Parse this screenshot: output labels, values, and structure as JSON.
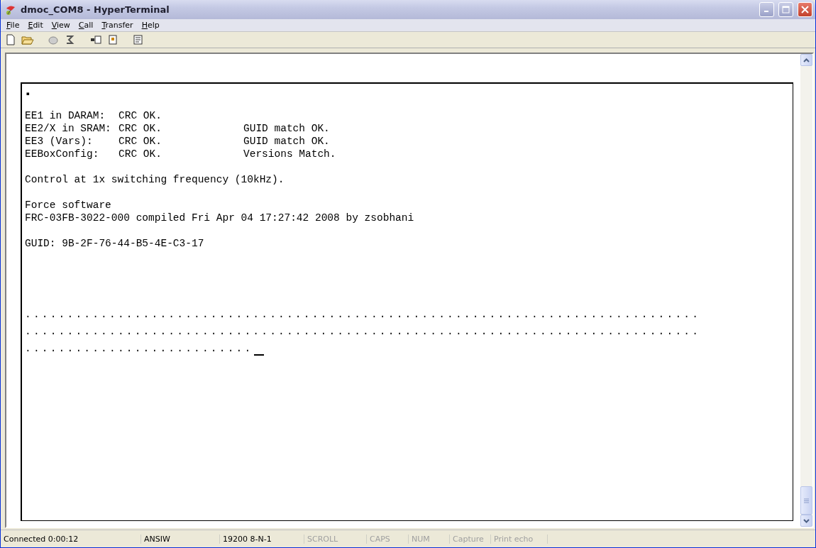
{
  "window": {
    "title": "dmoc_COM8 - HyperTerminal"
  },
  "menu": [
    {
      "label": "File"
    },
    {
      "label": "Edit"
    },
    {
      "label": "View"
    },
    {
      "label": "Call"
    },
    {
      "label": "Transfer"
    },
    {
      "label": "Help"
    }
  ],
  "terminal": {
    "marker": "▪",
    "checks": [
      {
        "name": "EE1 in DARAM:",
        "crc": "CRC OK."
      },
      {
        "name": "EE2/X in SRAM:",
        "crc": "CRC OK.",
        "detail": "GUID match OK."
      },
      {
        "name": "EE3 (Vars):",
        "crc": "CRC OK.",
        "detail": "GUID match OK."
      },
      {
        "name": "EEBoxConfig:",
        "crc": "CRC OK.",
        "detail": "Versions Match."
      }
    ],
    "paragraphs": [
      [
        "Control at 1x switching frequency (10kHz)."
      ],
      [
        "Force software",
        "FRC-03FB-3022-000 compiled Fri Apr 04 17:27:42 2008 by zsobhani"
      ],
      [
        "GUID: 9B-2F-76-44-B5-4E-C3-17"
      ]
    ],
    "progress": [
      "................................................................................",
      "................................................................................",
      "..........................."
    ],
    "cursor": true
  },
  "status_bar": [
    {
      "text": "Connected 0:00:12",
      "active": true
    },
    {
      "text": "ANSIW",
      "active": true
    },
    {
      "text": "19200 8-N-1",
      "active": true
    },
    {
      "text": "SCROLL",
      "active": false
    },
    {
      "text": "CAPS",
      "active": false
    },
    {
      "text": "NUM",
      "active": false
    },
    {
      "text": "Capture",
      "active": false
    },
    {
      "text": "Print echo",
      "active": false
    }
  ]
}
